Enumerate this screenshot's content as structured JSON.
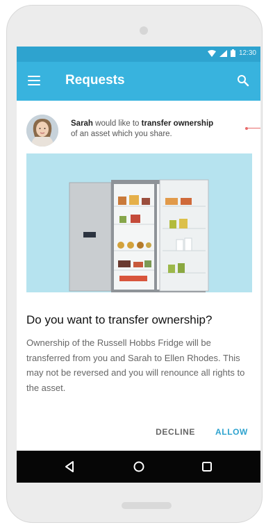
{
  "status_bar": {
    "time": "12:30"
  },
  "app_bar": {
    "title": "Requests"
  },
  "request": {
    "requester": "Sarah",
    "text_1": " would like to ",
    "action": "transfer ownership",
    "text_2": "of an asset which you share."
  },
  "dialog": {
    "question": "Do you want to transfer ownership?",
    "description": "Ownership of the Russell Hobbs Fridge will be transferred from you and Sarah to Ellen Rhodes. This may not be reversed and you will renounce all rights to the asset.",
    "decline_label": "DECLINE",
    "allow_label": "ALLOW"
  },
  "colors": {
    "status_bar": "#2ea3cf",
    "app_bar": "#38b3de",
    "accent": "#2ea3cf",
    "image_background": "#b6e3ef",
    "unread_marker": "#e86a6a"
  },
  "icons": [
    "wifi-icon",
    "signal-icon",
    "battery-icon",
    "menu-icon",
    "search-icon",
    "back-icon",
    "home-icon",
    "recents-icon"
  ]
}
